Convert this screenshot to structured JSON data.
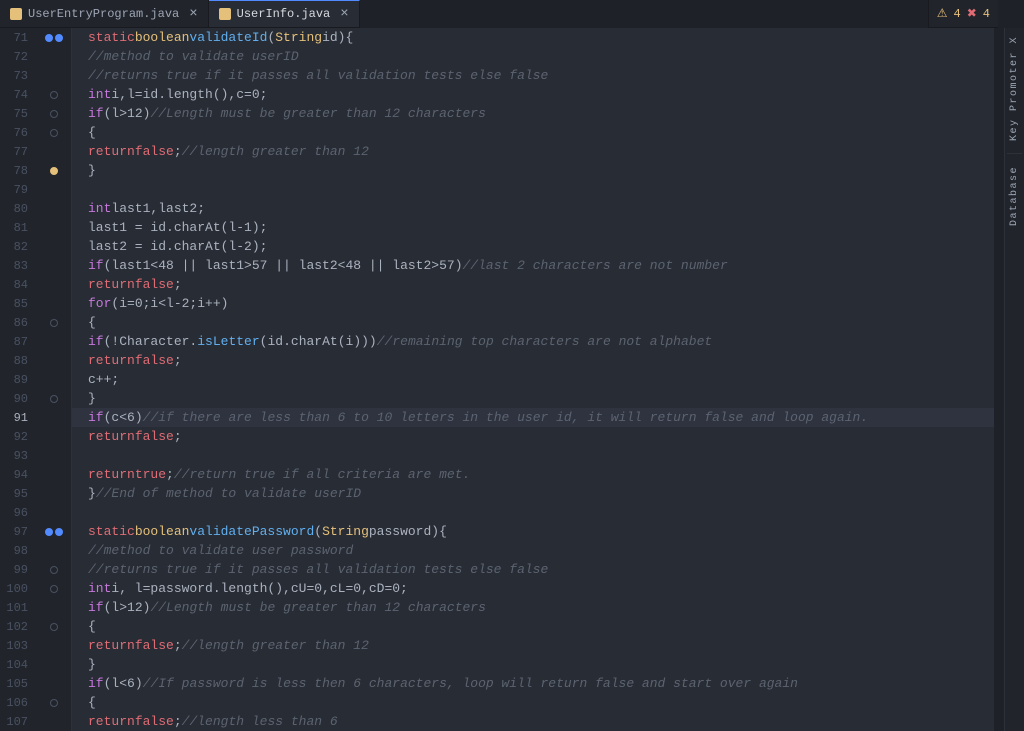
{
  "tabs": [
    {
      "id": "tab1",
      "label": "UserEntryProgram.java",
      "active": false
    },
    {
      "id": "tab2",
      "label": "UserInfo.java",
      "active": true
    }
  ],
  "statusBar": {
    "warnings": "4",
    "errors": "4",
    "warnLabel": "⚠ 4",
    "errLabel": "✖ 4"
  },
  "rightPanels": [
    {
      "id": "p1",
      "label": "Key Promoter X"
    },
    {
      "id": "p2",
      "label": "Database"
    }
  ],
  "lines": [
    {
      "num": 71,
      "icons": [
        "blue",
        "blue"
      ],
      "code": "<span class='kw2'>static</span> <span class='type'>boolean</span> <span class='fn'>validateId</span><span class='paren'>(</span><span class='type'>String</span> id<span class='paren'>)</span> <span class='paren'>{</span>"
    },
    {
      "num": 72,
      "icons": [],
      "code": "<span class='cm'>//method to validate userID</span>"
    },
    {
      "num": 73,
      "icons": [],
      "code": "<span class='cm'>//returns true if it passes all validation tests else false</span>"
    },
    {
      "num": 74,
      "icons": [
        "outline"
      ],
      "code": "<span class='kw'>int</span> i,l=id.length(),c=0;"
    },
    {
      "num": 75,
      "icons": [
        "outline"
      ],
      "code": "<span class='kw'>if</span><span class='paren'>(</span>l&gt;12<span class='paren'>)</span> <span class='cm'>//Length must be greater than 12 characters</span>"
    },
    {
      "num": 76,
      "icons": [
        "outline"
      ],
      "code": "<span class='paren'>{</span>"
    },
    {
      "num": 77,
      "icons": [],
      "code": "<span class='kw2'>return</span> <span class='kw2'>false</span>;       <span class='cm'>//length greater than 12</span>"
    },
    {
      "num": 78,
      "icons": [
        "orange"
      ],
      "code": "<span class='paren'>}</span>"
    },
    {
      "num": 79,
      "icons": [],
      "code": ""
    },
    {
      "num": 80,
      "icons": [],
      "code": "<span class='kw'>int</span> last1,last2;"
    },
    {
      "num": 81,
      "icons": [],
      "code": "last1 = id.charAt<span class='paren'>(</span>l-1<span class='paren'>)</span>;"
    },
    {
      "num": 82,
      "icons": [],
      "code": "last2 = id.charAt<span class='paren'>(</span>l-2<span class='paren'>)</span>;"
    },
    {
      "num": 83,
      "icons": [],
      "code": "<span class='kw'>if</span><span class='paren'>(</span>last1&lt;48 || last1&gt;57 || last2&lt;48 || last2&gt;57<span class='paren'>)</span>  <span class='cm'>//last 2 characters are not number</span>"
    },
    {
      "num": 84,
      "icons": [],
      "code": "<span class='kw2'>return</span> <span class='kw2'>false</span>;"
    },
    {
      "num": 85,
      "icons": [],
      "code": "<span class='kw'>for</span><span class='paren'>(</span>i=0;i&lt;l-2;i++<span class='paren'>)</span>"
    },
    {
      "num": 86,
      "icons": [
        "outline"
      ],
      "code": "<span class='paren'>{</span>"
    },
    {
      "num": 87,
      "icons": [],
      "code": "<span class='kw'>if</span><span class='paren'>(</span>!Character.<span class='fn'>isLetter</span><span class='paren'>(</span>id.charAt<span class='paren'>(</span>i<span class='paren'>)))</span>  <span class='cm'>//remaining top characters are not alphabet</span>"
    },
    {
      "num": 88,
      "icons": [],
      "code": "<span class='kw2'>return</span> <span class='kw2'>false</span>;"
    },
    {
      "num": 89,
      "icons": [],
      "code": "c++;"
    },
    {
      "num": 90,
      "icons": [
        "outline"
      ],
      "code": "<span class='paren'>}</span>"
    },
    {
      "num": 91,
      "icons": [
        "highlight"
      ],
      "code": "<span class='kw'>if</span><span class='paren'>(</span>c&lt;6<span class='paren'>)</span><span class='cm'>//if there are less than 6 to 10 letters in the user id, it will return false and loop again.</span>",
      "highlight": true
    },
    {
      "num": 92,
      "icons": [],
      "code": "<span class='kw2'>return</span> <span class='kw2'>false</span>;"
    },
    {
      "num": 93,
      "icons": [],
      "code": ""
    },
    {
      "num": 94,
      "icons": [],
      "code": "<span class='kw2'>return</span> <span class='kw2'>true</span>;<span class='cm'>//return true if all criteria are met.</span>"
    },
    {
      "num": 95,
      "icons": [],
      "code": "<span class='paren'>}</span><span class='cm'>//End of method to validate userID</span>"
    },
    {
      "num": 96,
      "icons": [],
      "code": ""
    },
    {
      "num": 97,
      "icons": [
        "blue",
        "blue"
      ],
      "code": "<span class='kw2'>static</span> <span class='type'>boolean</span> <span class='fn'>validatePassword</span><span class='paren'>(</span><span class='type'>String</span> password<span class='paren'>)</span> <span class='paren'>{</span>"
    },
    {
      "num": 98,
      "icons": [],
      "code": "<span class='cm'>//method to validate user password</span>"
    },
    {
      "num": 99,
      "icons": [
        "outline"
      ],
      "code": "<span class='cm'>//returns true if it passes all validation tests else false</span>"
    },
    {
      "num": 100,
      "icons": [
        "outline"
      ],
      "code": "<span class='kw'>int</span> i, l=password.length(),cU=0,cL=0,cD=0;"
    },
    {
      "num": 101,
      "icons": [],
      "code": "<span class='kw'>if</span><span class='paren'>(</span>l&gt;12<span class='paren'>)</span> <span class='cm'>//Length must be greater than 12 characters</span>"
    },
    {
      "num": 102,
      "icons": [
        "outline"
      ],
      "code": "<span class='paren'>{</span>"
    },
    {
      "num": 103,
      "icons": [],
      "code": "<span class='kw2'>return</span> <span class='kw2'>false</span>;<span class='cm'>//length greater than 12</span>"
    },
    {
      "num": 104,
      "icons": [],
      "code": "<span class='paren'>}</span>"
    },
    {
      "num": 105,
      "icons": [],
      "code": "<span class='kw'>if</span><span class='paren'>(</span>l&lt;6<span class='paren'>)</span> <span class='cm'>//If password is less then 6 characters, loop will return false and start over again</span>"
    },
    {
      "num": 106,
      "icons": [
        "outline"
      ],
      "code": "<span class='paren'>{</span>"
    },
    {
      "num": 107,
      "icons": [],
      "code": "<span class='kw2'>return</span> <span class='kw2'>false</span>;<span class='cm'>//length less than 6</span>"
    }
  ]
}
